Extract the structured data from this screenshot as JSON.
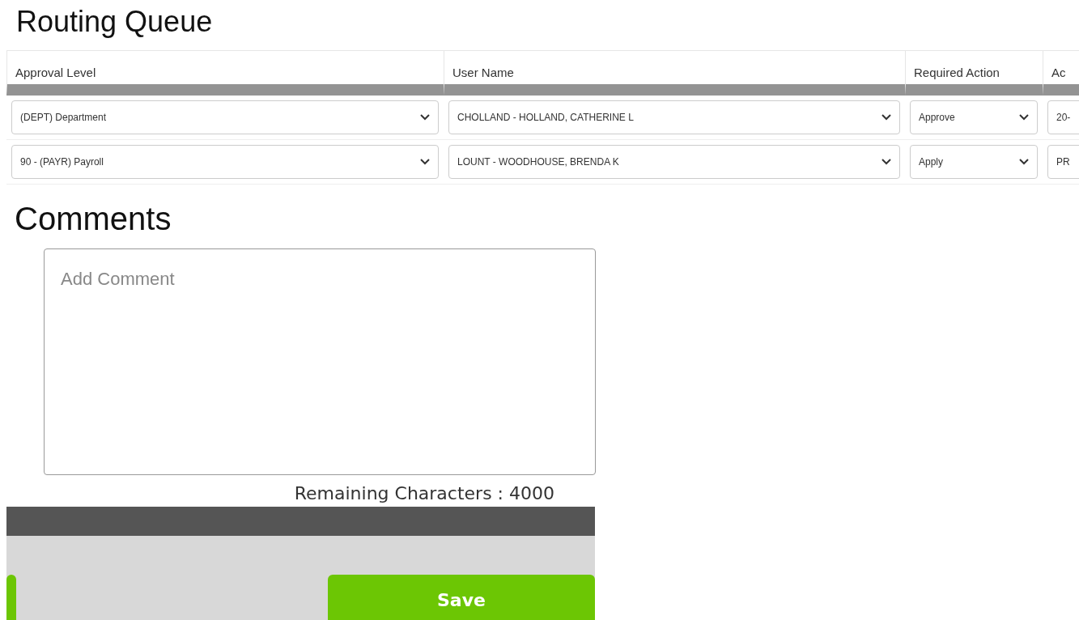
{
  "title": "Routing Queue",
  "table": {
    "columns": [
      "Approval Level",
      "User Name",
      "Required Action",
      "Ac"
    ],
    "rows": [
      {
        "cells": [
          "(DEPT) Department",
          "CHOLLAND - HOLLAND, CATHERINE L",
          "Approve",
          "20-"
        ]
      },
      {
        "cells": [
          "90 - (PAYR) Payroll",
          "LOUNT - WOODHOUSE, BRENDA K",
          "Apply",
          "PR"
        ]
      }
    ]
  },
  "comments": {
    "title": "Comments",
    "placeholder": "Add Comment",
    "remaining": "Remaining Characters : 4000"
  },
  "footer": {
    "buttons": [
      {
        "kind": "partial"
      },
      {
        "label": "Save",
        "kind": "primary"
      }
    ]
  }
}
